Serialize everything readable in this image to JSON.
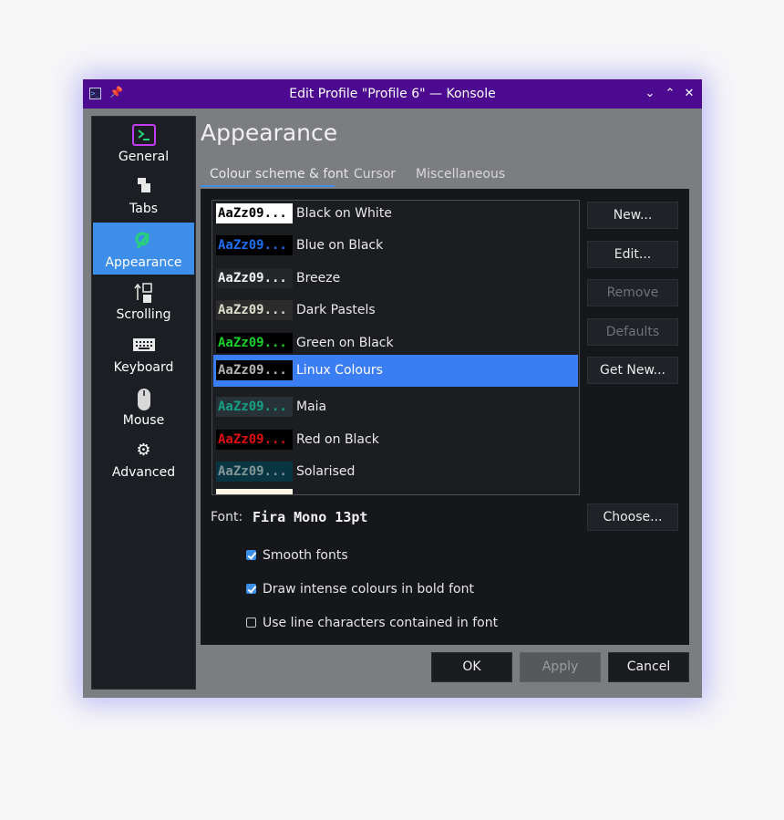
{
  "window": {
    "title": "Edit Profile \"Profile 6\" — Konsole",
    "app_icon_glyph": ">_",
    "pin_glyph": "📌",
    "minimize_glyph": "⌄",
    "maximize_glyph": "⌃",
    "close_glyph": "✕"
  },
  "sidebar": {
    "items": [
      {
        "label": "General",
        "icon": "terminal-icon",
        "glyph": "⧉"
      },
      {
        "label": "Tabs",
        "icon": "tabs-icon",
        "glyph": "▞"
      },
      {
        "label": "Appearance",
        "icon": "palette-icon",
        "glyph": "✎"
      },
      {
        "label": "Scrolling",
        "icon": "scroll-icon",
        "glyph": "⇅"
      },
      {
        "label": "Keyboard",
        "icon": "keyboard-icon",
        "glyph": "⌨"
      },
      {
        "label": "Mouse",
        "icon": "mouse-icon",
        "glyph": "⬮"
      },
      {
        "label": "Advanced",
        "icon": "gear-icon",
        "glyph": "⚙"
      }
    ],
    "active": "Appearance"
  },
  "page": {
    "title": "Appearance",
    "tabs": [
      "Colour scheme & font",
      "Cursor",
      "Miscellaneous"
    ],
    "active_tab": "Colour scheme & font"
  },
  "schemes": [
    {
      "sample": "AaZz09...",
      "name": "Black on White",
      "bg": "#ffffff",
      "fg": "#000000"
    },
    {
      "sample": "AaZz09...",
      "name": "Blue on Black",
      "bg": "#000000",
      "fg": "#1e6ff0"
    },
    {
      "sample": "AaZz09...",
      "name": "Breeze",
      "bg": "#232629",
      "fg": "#eff0f1"
    },
    {
      "sample": "AaZz09...",
      "name": "Dark Pastels",
      "bg": "#2c2c2c",
      "fg": "#dcdccc"
    },
    {
      "sample": "AaZz09...",
      "name": "Green on Black",
      "bg": "#000000",
      "fg": "#18d02c"
    },
    {
      "sample": "AaZz09...",
      "name": "Linux Colours",
      "bg": "#000000",
      "fg": "#b2b2b2"
    },
    {
      "sample": "AaZz09...",
      "name": "Maia",
      "bg": "#263238",
      "fg": "#16a085"
    },
    {
      "sample": "AaZz09...",
      "name": "Red on Black",
      "bg": "#000000",
      "fg": "#e01010"
    },
    {
      "sample": "AaZz09...",
      "name": "Solarised",
      "bg": "#073642",
      "fg": "#839496"
    }
  ],
  "selected_scheme": "Linux Colours",
  "scheme_buttons": {
    "new": "New...",
    "edit": "Edit...",
    "remove": "Remove",
    "defaults": "Defaults",
    "get_new": "Get New..."
  },
  "font": {
    "label": "Font:",
    "value": "Fira Mono 13pt",
    "choose": "Choose..."
  },
  "options": [
    {
      "label": "Smooth fonts",
      "checked": true
    },
    {
      "label": "Draw intense colours in bold font",
      "checked": true
    },
    {
      "label": "Use line characters contained in font",
      "checked": false
    }
  ],
  "footer": {
    "ok": "OK",
    "apply": "Apply",
    "cancel": "Cancel"
  },
  "colors": {
    "accent": "#3d8ee8",
    "titlebar": "#4b0a8f"
  }
}
